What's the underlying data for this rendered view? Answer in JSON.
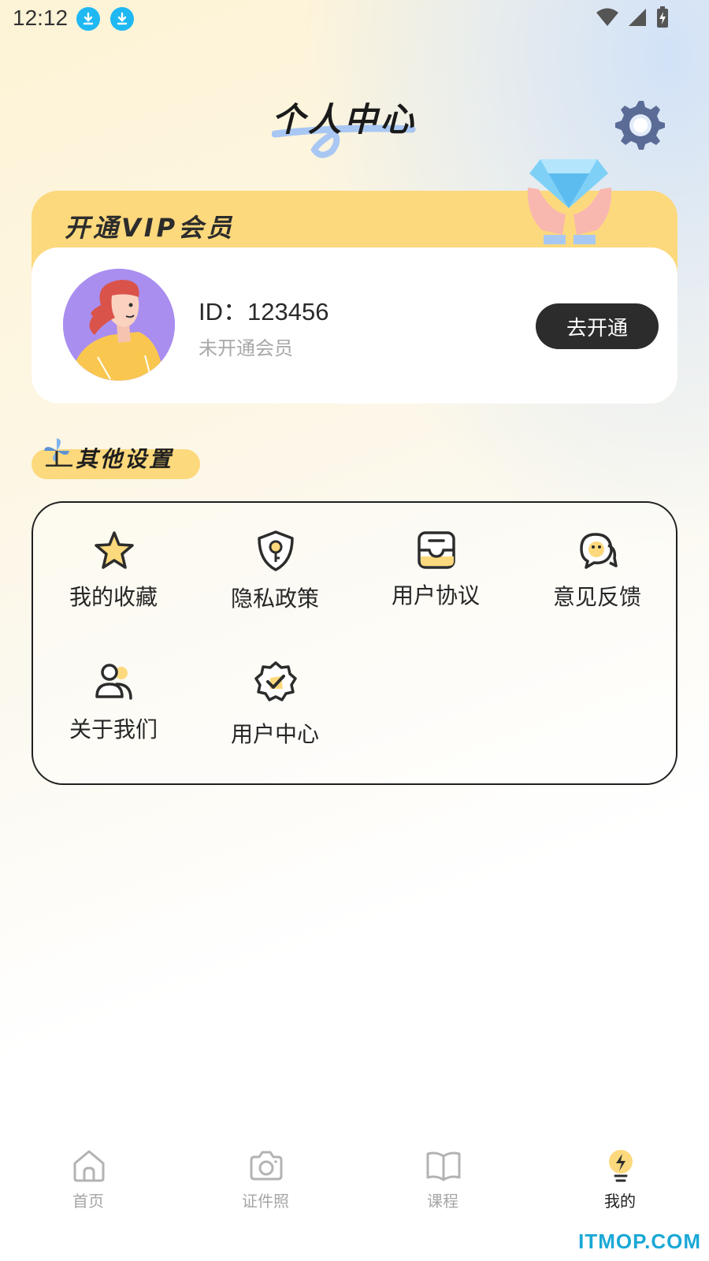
{
  "status_bar": {
    "time": "12:12"
  },
  "header": {
    "title": "个人中心"
  },
  "vip": {
    "banner": "开通VIP会员",
    "user_id": "ID：123456",
    "status": "未开通会员",
    "button": "去开通"
  },
  "section": {
    "title": "其他设置",
    "items": [
      {
        "label": "我的收藏",
        "icon": "star-icon"
      },
      {
        "label": "隐私政策",
        "icon": "shield-key-icon"
      },
      {
        "label": "用户协议",
        "icon": "inbox-icon"
      },
      {
        "label": "意见反馈",
        "icon": "chat-bubble-icon"
      },
      {
        "label": "关于我们",
        "icon": "users-icon"
      },
      {
        "label": "用户中心",
        "icon": "badge-check-icon"
      }
    ]
  },
  "bottom_nav": {
    "items": [
      {
        "label": "首页",
        "icon": "home-icon"
      },
      {
        "label": "证件照",
        "icon": "camera-icon"
      },
      {
        "label": "课程",
        "icon": "book-icon"
      },
      {
        "label": "我的",
        "icon": "lightbulb-icon",
        "active": true
      }
    ]
  },
  "watermark": "ITMOP.COM",
  "colors": {
    "accent": "#fdd97d",
    "dark": "#2c2c2c",
    "muted": "#a8a8a8",
    "download": "#1fb8f3"
  }
}
